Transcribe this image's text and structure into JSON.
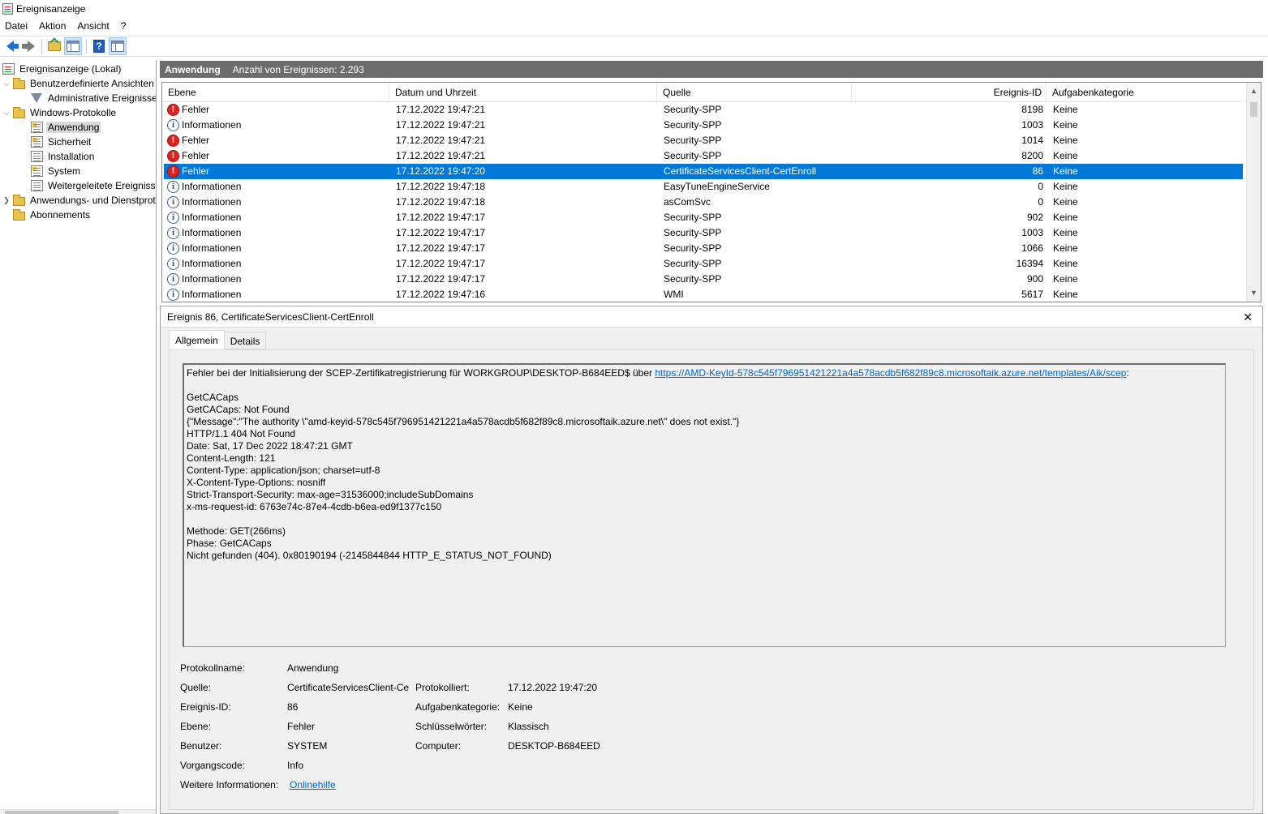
{
  "window": {
    "title": "Ereignisanzeige"
  },
  "menu": [
    "Datei",
    "Aktion",
    "Ansicht",
    "?"
  ],
  "toolbar": {
    "buttons": [
      "back-icon",
      "forward-icon",
      "folder-up-icon",
      "show-pane-icon",
      "help-icon",
      "action-pane-icon"
    ]
  },
  "tree": {
    "items": [
      {
        "label": "Ereignisanzeige (Lokal)",
        "icon": "event-viewer-icon"
      },
      {
        "label": "Benutzerdefinierte Ansichten",
        "icon": "folder-icon",
        "expander": "expanded"
      },
      {
        "label": "Administrative Ereignisse",
        "icon": "filter-icon"
      },
      {
        "label": "Windows-Protokolle",
        "icon": "folder-icon",
        "expander": "expanded"
      },
      {
        "label": "Anwendung",
        "icon": "log-icon",
        "selected": true
      },
      {
        "label": "Sicherheit",
        "icon": "log-icon"
      },
      {
        "label": "Installation",
        "icon": "log-icon"
      },
      {
        "label": "System",
        "icon": "log-icon"
      },
      {
        "label": "Weitergeleitete Ereignisse",
        "icon": "log-icon"
      },
      {
        "label": "Anwendungs- und Dienstprotokolle",
        "icon": "folder-icon",
        "expander": "collapsed"
      },
      {
        "label": "Abonnements",
        "icon": "folder-icon"
      }
    ]
  },
  "header": {
    "log_name": "Anwendung",
    "count_text": "Anzahl von Ereignissen: 2.293"
  },
  "columns": [
    "Ebene",
    "Datum und Uhrzeit",
    "Quelle",
    "Ereignis-ID",
    "Aufgabenkategorie"
  ],
  "events": [
    {
      "level": "Fehler",
      "level_icon": "error-icon",
      "date": "17.12.2022 19:47:21",
      "source": "Security-SPP",
      "id": "8198",
      "category": "Keine"
    },
    {
      "level": "Informationen",
      "level_icon": "info-icon",
      "date": "17.12.2022 19:47:21",
      "source": "Security-SPP",
      "id": "1003",
      "category": "Keine"
    },
    {
      "level": "Fehler",
      "level_icon": "error-icon",
      "date": "17.12.2022 19:47:21",
      "source": "Security-SPP",
      "id": "1014",
      "category": "Keine"
    },
    {
      "level": "Fehler",
      "level_icon": "error-icon",
      "date": "17.12.2022 19:47:21",
      "source": "Security-SPP",
      "id": "8200",
      "category": "Keine"
    },
    {
      "level": "Fehler",
      "level_icon": "error-icon",
      "date": "17.12.2022 19:47:20",
      "source": "CertificateServicesClient-CertEnroll",
      "id": "86",
      "category": "Keine",
      "selected": true
    },
    {
      "level": "Informationen",
      "level_icon": "info-icon",
      "date": "17.12.2022 19:47:18",
      "source": "EasyTuneEngineService",
      "id": "0",
      "category": "Keine"
    },
    {
      "level": "Informationen",
      "level_icon": "info-icon",
      "date": "17.12.2022 19:47:18",
      "source": "asComSvc",
      "id": "0",
      "category": "Keine"
    },
    {
      "level": "Informationen",
      "level_icon": "info-icon",
      "date": "17.12.2022 19:47:17",
      "source": "Security-SPP",
      "id": "902",
      "category": "Keine"
    },
    {
      "level": "Informationen",
      "level_icon": "info-icon",
      "date": "17.12.2022 19:47:17",
      "source": "Security-SPP",
      "id": "1003",
      "category": "Keine"
    },
    {
      "level": "Informationen",
      "level_icon": "info-icon",
      "date": "17.12.2022 19:47:17",
      "source": "Security-SPP",
      "id": "1066",
      "category": "Keine"
    },
    {
      "level": "Informationen",
      "level_icon": "info-icon",
      "date": "17.12.2022 19:47:17",
      "source": "Security-SPP",
      "id": "16394",
      "category": "Keine"
    },
    {
      "level": "Informationen",
      "level_icon": "info-icon",
      "date": "17.12.2022 19:47:17",
      "source": "Security-SPP",
      "id": "900",
      "category": "Keine"
    },
    {
      "level": "Informationen",
      "level_icon": "info-icon",
      "date": "17.12.2022 19:47:16",
      "source": "WMI",
      "id": "5617",
      "category": "Keine"
    }
  ],
  "detail": {
    "title": "Ereignis 86, CertificateServicesClient-CertEnroll",
    "close": "✕",
    "tabs": [
      "Allgemein",
      "Details"
    ],
    "message_prefix": "Fehler bei der Initialisierung der SCEP-Zertifikatregistrierung für WORKGROUP\\DESKTOP-B684EED$ über ",
    "message_link": "https://AMD-KeyId-578c545f796951421221a4a578acdb5f682f89c8.microsoftaik.azure.net/templates/Aik/scep",
    "message_suffix": ":",
    "message_lines": [
      "",
      "GetCACaps",
      "GetCACaps: Not Found",
      "{\"Message\":\"The authority \\\"amd-keyid-578c545f796951421221a4a578acdb5f682f89c8.microsoftaik.azure.net\\\" does not exist.\"}",
      "HTTP/1.1 404 Not Found",
      "Date: Sat, 17 Dec 2022 18:47:21 GMT",
      "Content-Length: 121",
      "Content-Type: application/json; charset=utf-8",
      "X-Content-Type-Options: nosniff",
      "Strict-Transport-Security: max-age=31536000;includeSubDomains",
      "x-ms-request-id: 6763e74c-87e4-4cdb-b6ea-ed9f1377c150",
      "",
      "Methode: GET(266ms)",
      "Phase: GetCACaps",
      "Nicht gefunden (404). 0x80190194 (-2145844844 HTTP_E_STATUS_NOT_FOUND)"
    ],
    "props": {
      "protokollname_label": "Protokollname:",
      "protokollname": "Anwendung",
      "quelle_label": "Quelle:",
      "quelle": "CertificateServicesClient-CertEnroll",
      "protokolliert_label": "Protokolliert:",
      "protokolliert": "17.12.2022 19:47:20",
      "ereignis_id_label": "Ereignis-ID:",
      "ereignis_id": "86",
      "aufgabenkategorie_label": "Aufgabenkategorie:",
      "aufgabenkategorie": "Keine",
      "ebene_label": "Ebene:",
      "ebene": "Fehler",
      "schluesselwoerter_label": "Schlüsselwörter:",
      "schluesselwoerter": "Klassisch",
      "benutzer_label": "Benutzer:",
      "benutzer": "SYSTEM",
      "computer_label": "Computer:",
      "computer": "DESKTOP-B684EED",
      "vorgangscode_label": "Vorgangscode:",
      "vorgangscode": "Info",
      "weitere_label": "Weitere Informationen:",
      "weitere_link": "Onlinehilfe"
    }
  }
}
